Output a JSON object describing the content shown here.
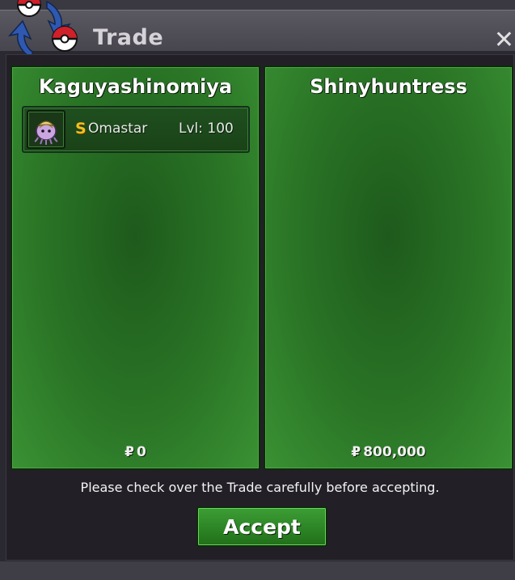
{
  "window": {
    "title": "Trade",
    "close_icon": "close-icon"
  },
  "trade": {
    "left": {
      "player_name": "Kaguyashinomiya",
      "currency_symbol": "₽",
      "money": "0",
      "items": [
        {
          "icon": "omastar-sprite-icon",
          "shiny_badge": "S",
          "pokemon": "Omastar",
          "level": "Lvl: 100"
        }
      ]
    },
    "right": {
      "player_name": "Shinyhuntress",
      "currency_symbol": "₽",
      "money": "800,000",
      "items": []
    }
  },
  "footer": {
    "notice": "Please check over the Trade carefully before accepting.",
    "accept_label": "Accept"
  },
  "colors": {
    "panel_green": "#2a7526",
    "window_bg": "#221f27",
    "title_bar": "#4f4d55",
    "shiny_gold": "#f0c020"
  }
}
